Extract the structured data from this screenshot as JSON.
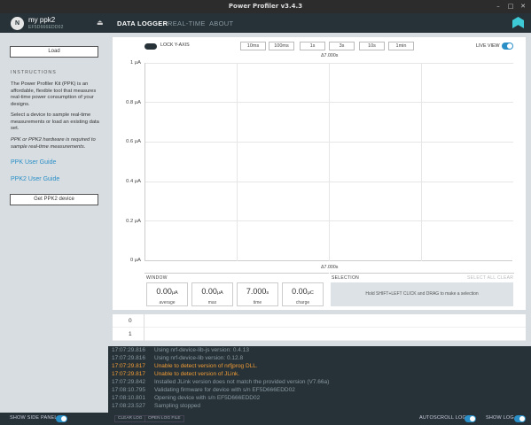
{
  "window": {
    "title": "Power Profiler v3.4.3"
  },
  "device": {
    "icon_letter": "N",
    "name": "my ppk2",
    "serial": "EF5D666EDD02"
  },
  "tabs": [
    {
      "label": "DATA LOGGER",
      "active": true
    },
    {
      "label": "REAL-TIME",
      "active": false
    },
    {
      "label": "ABOUT",
      "active": false
    }
  ],
  "sidebar": {
    "load_label": "Load",
    "instructions_heading": "INSTRUCTIONS",
    "para1": "The Power Profiler Kit (PPK) is an affordable, flexible tool that measures real-time power consumption of your designs.",
    "para2": "Select a device to sample real-time measurements or load an existing data set.",
    "para3": "PPK or PPK2 hardware is required to sample real-time measurements.",
    "link1": "PPK User Guide",
    "link2": "PPK2 User Guide",
    "get_device_label": "Get PPK2 device"
  },
  "chart_controls": {
    "lock_y_label": "LOCK Y-AXIS",
    "windows": [
      "10ms",
      "100ms",
      "1s",
      "3s",
      "10s",
      "1min"
    ],
    "live_view_label": "LIVE VIEW",
    "live_view_on": true,
    "delta_top": "Δ7.000s",
    "delta_bottom": "Δ7.000s"
  },
  "chart_data": {
    "type": "line",
    "yticks": [
      "1 μA",
      "0.8 μA",
      "0.6 μA",
      "0.4 μA",
      "0.2 μA",
      "0 μA"
    ],
    "ylim": [
      0,
      1
    ],
    "series": []
  },
  "window_stats": {
    "heading": "WINDOW",
    "items": [
      {
        "value": "0.00",
        "unit": "μA",
        "label": "average"
      },
      {
        "value": "0.00",
        "unit": "μA",
        "label": "max"
      },
      {
        "value": "7.000",
        "unit": "s",
        "label": "time"
      },
      {
        "value": "0.00",
        "unit": "μC",
        "label": "charge"
      }
    ]
  },
  "selection": {
    "heading": "SELECTION",
    "select_all": "SELECT ALL",
    "clear": "CLEAR",
    "hint": "Hold SHIFT+LEFT CLICK and DRAG to make a selection"
  },
  "digital_channels": [
    "0",
    "1"
  ],
  "log": [
    {
      "ts": "17:07:29.816",
      "msg": "Using nrf-device-lib-js version: 0.4.13",
      "level": "info"
    },
    {
      "ts": "17:07:29.816",
      "msg": "Using nrf-device-lib version: 0.12.8",
      "level": "info"
    },
    {
      "ts": "17:07:29.817",
      "msg": "Unable to detect version of nrfjprog DLL.",
      "level": "warn"
    },
    {
      "ts": "17:07:29.817",
      "msg": "Unable to detect version of JLink.",
      "level": "warn"
    },
    {
      "ts": "17:07:29.842",
      "msg": "Installed JLink version does not match the provided version (V7.66a)",
      "level": "info"
    },
    {
      "ts": "17:08:10.795",
      "msg": "Validating firmware for device with s/n EF5D666EDD02",
      "level": "info"
    },
    {
      "ts": "17:08:10.801",
      "msg": "Opening device with s/n EF5D666EDD02",
      "level": "info"
    },
    {
      "ts": "17:08:23.527",
      "msg": "Sampling stopped",
      "level": "info"
    }
  ],
  "footer": {
    "show_side_panel": "SHOW SIDE PANEL",
    "clear_log": "CLEAR LOG",
    "open_log_file": "OPEN LOG FILE",
    "autoscroll_log": "AUTOSCROLL LOG",
    "show_log": "SHOW LOG"
  }
}
